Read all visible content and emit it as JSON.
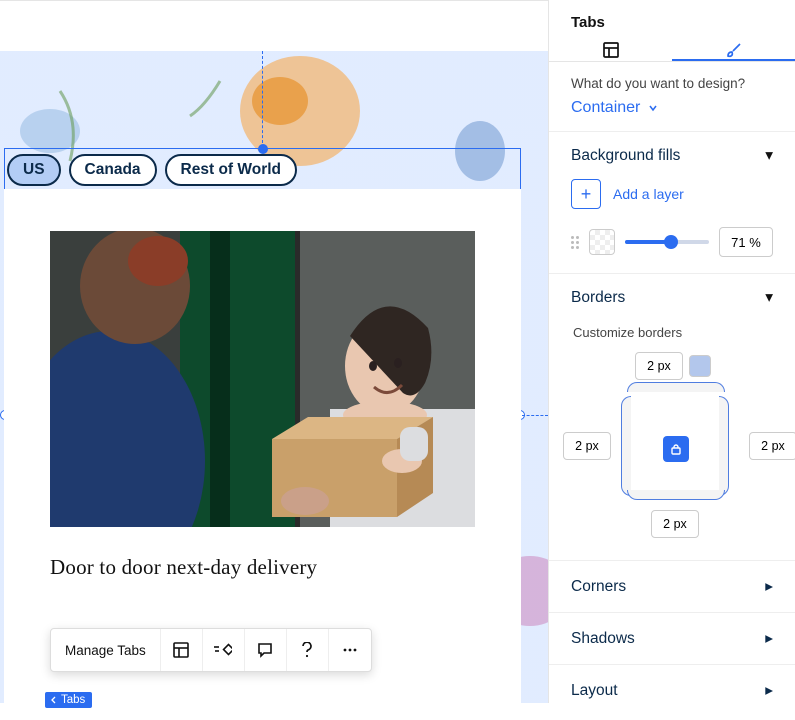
{
  "canvas": {
    "tabs_widget": {
      "tabs": [
        "US",
        "Canada",
        "Rest of World"
      ],
      "active_index": 0,
      "content": {
        "caption": "Door to door next-day delivery"
      },
      "toolbar": {
        "manage": "Manage Tabs"
      },
      "badge": "Tabs"
    }
  },
  "panel": {
    "title": "Tabs",
    "design_prompt": "What do you want to design?",
    "design_target": "Container",
    "sections": {
      "background_fills": {
        "title": "Background fills",
        "add_layer": "Add a layer",
        "opacity_value": "71",
        "opacity_unit": "%",
        "opacity_pct": 71
      },
      "borders": {
        "title": "Borders",
        "subtitle": "Customize borders",
        "top": "2 px",
        "right": "2 px",
        "bottom": "2 px",
        "left": "2 px"
      },
      "corners": {
        "title": "Corners"
      },
      "shadows": {
        "title": "Shadows"
      },
      "layout": {
        "title": "Layout"
      }
    }
  }
}
